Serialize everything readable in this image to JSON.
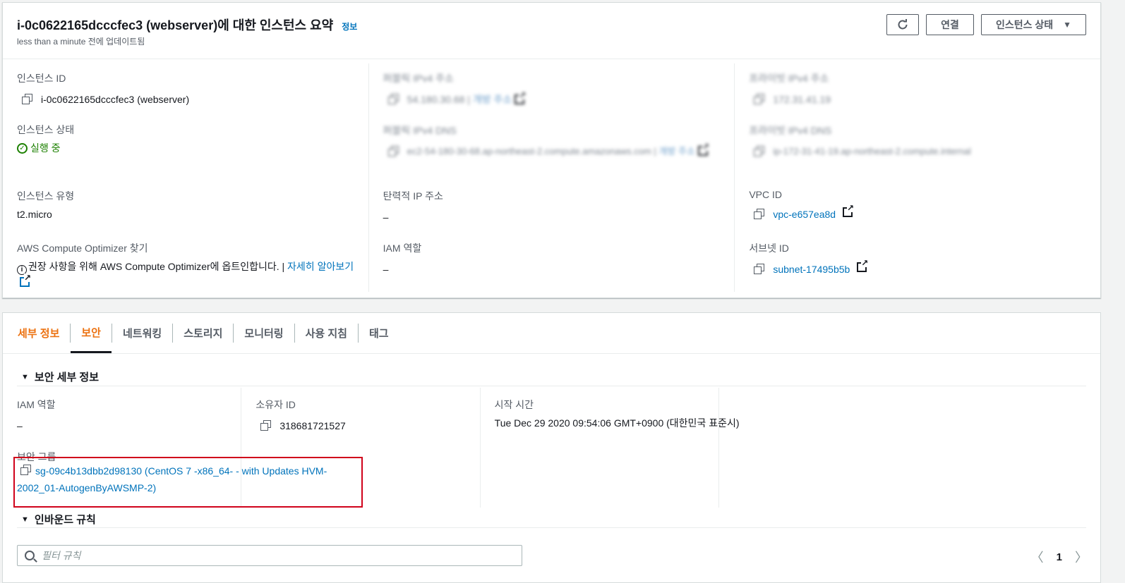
{
  "header": {
    "title": "i-0c0622165dcccfec3 (webserver)에 대한 인스턴스 요약",
    "info_link": "정보",
    "subtitle": "less than a minute 전에 업데이트됨",
    "refresh_icon": "refresh-icon",
    "connect_label": "연결",
    "instance_state_label": "인스턴스 상태"
  },
  "summary": {
    "instance_id": {
      "label": "인스턴스 ID",
      "value": "i-0c0622165dcccfec3 (webserver)"
    },
    "public_ipv4": {
      "label": "퍼블릭 IPv4 주소",
      "value": "54.180.30.68",
      "sep": " | ",
      "link": "개방 주소"
    },
    "private_ipv4": {
      "label": "프라이빗 IPv4 주소",
      "value": "172.31.41.19"
    },
    "instance_state": {
      "label": "인스턴스 상태",
      "value": "실행 중"
    },
    "public_dns": {
      "label": "퍼블릭 IPv4 DNS",
      "value": "ec2-54-180-30-68.ap-northeast-2.compute.amazonaws.com",
      "sep": " | ",
      "link": "개방 주소"
    },
    "private_dns": {
      "label": "프라이빗 IPv4 DNS",
      "value": "ip-172-31-41-19.ap-northeast-2.compute.internal"
    },
    "instance_type": {
      "label": "인스턴스 유형",
      "value": "t2.micro"
    },
    "elastic_ip": {
      "label": "탄력적 IP 주소",
      "value": "–"
    },
    "vpc_id": {
      "label": "VPC ID",
      "value": "vpc-e657ea8d"
    },
    "optimizer": {
      "label": "AWS Compute Optimizer 찾기",
      "text": "권장 사항을 위해 AWS Compute Optimizer에 옵트인합니다. | ",
      "link": "자세히 알아보기"
    },
    "iam_role": {
      "label": "IAM 역할",
      "value": "–"
    },
    "subnet_id": {
      "label": "서브넷 ID",
      "value": "subnet-17495b5b"
    }
  },
  "tabs": [
    "세부 정보",
    "보안",
    "네트워킹",
    "스토리지",
    "모니터링",
    "사용 지침",
    "태그"
  ],
  "active_tab": "보안",
  "security": {
    "section_title": "보안 세부 정보",
    "iam_role": {
      "label": "IAM 역할",
      "value": "–"
    },
    "owner_id": {
      "label": "소유자 ID",
      "value": "318681721527"
    },
    "launch_time": {
      "label": "시작 시간",
      "value": "Tue Dec 29 2020 09:54:06 GMT+0900 (대한민국 표준시)"
    },
    "security_groups": {
      "label": "보안 그룹",
      "value": "sg-09c4b13dbb2d98130 (CentOS 7 -x86_64- - with Updates HVM-2002_01-AutogenByAWSMP-2)"
    }
  },
  "inbound": {
    "section_title": "인바운드 규칙",
    "filter_placeholder": "필터 규칙",
    "page": "1"
  },
  "colors": {
    "accent": "#ec7211",
    "link": "#0073bb",
    "success": "#1d8102",
    "highlight": "#d0021b"
  }
}
